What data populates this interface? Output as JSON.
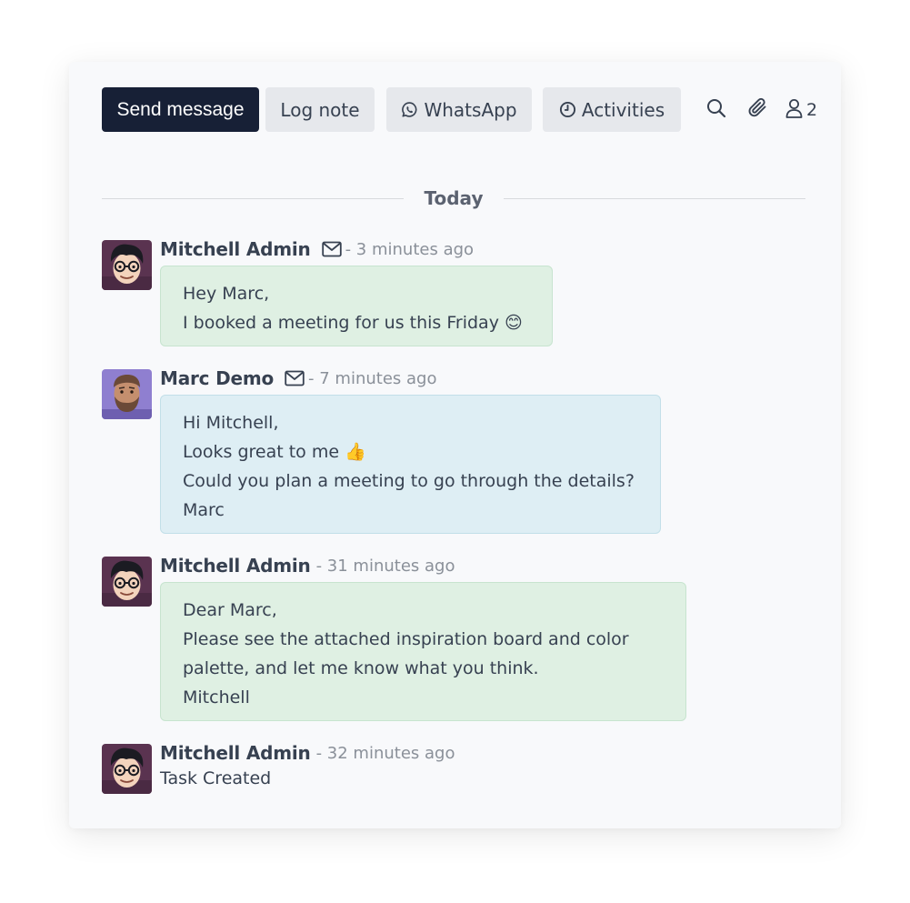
{
  "composer": {
    "send_message_label": "Send message",
    "log_note_label": "Log note",
    "whatsapp_label": "WhatsApp",
    "activities_label": "Activities",
    "followers_count": "2"
  },
  "separator": {
    "label": "Today"
  },
  "messages": [
    {
      "author": "Mitchell Admin",
      "date": "- 3 minutes ago",
      "lines": [
        "Hey Marc,",
        "I booked a meeting for us this Friday 😊"
      ]
    },
    {
      "author": "Marc Demo",
      "date": "- 7 minutes ago",
      "lines": [
        "Hi Mitchell,",
        "Looks great to me 👍",
        "Could you plan a meeting to go through the details?",
        "Marc"
      ]
    },
    {
      "author": "Mitchell Admin",
      "date": "- 31 minutes ago",
      "lines": [
        "Dear Marc,",
        "Please see the attached inspiration board and color",
        "palette, and let me know what you think.",
        "Mitchell"
      ]
    },
    {
      "author": "Mitchell Admin",
      "date": "- 32 minutes ago",
      "body": "Task Created"
    }
  ],
  "icons": {
    "whatsapp": "whatsapp-icon",
    "activities": "clock-icon",
    "search": "search-icon",
    "attachments": "paperclip-icon",
    "followers": "user-icon",
    "envelope": "envelope-icon"
  },
  "colors": {
    "primary_button": "#172036",
    "secondary_button": "#e6e8ec",
    "outgoing_bubble": "#dff0e3",
    "incoming_bubble": "#deeef4"
  }
}
